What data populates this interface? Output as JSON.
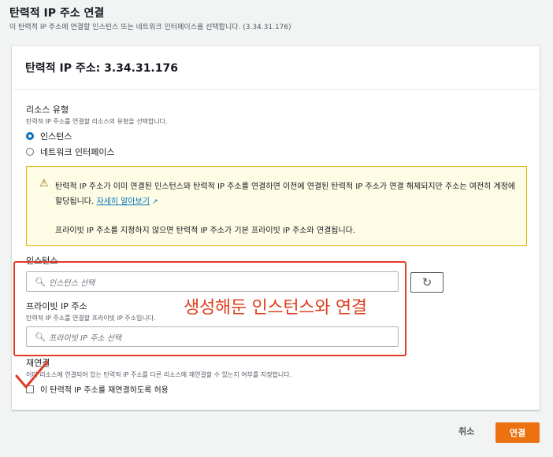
{
  "page": {
    "title": "탄력적 IP 주소 연결",
    "description": "이 탄력적 IP 주소에 연결할 인스턴스 또는 네트워크 인터페이스를 선택합니다. (3.34.31.176)"
  },
  "panel": {
    "title": "탄력적 IP 주소: 3.34.31.176"
  },
  "resource_type": {
    "label": "리소스 유형",
    "hint": "탄력적 IP 주소를 연결할 리소스의 유형을 선택합니다.",
    "options": [
      {
        "label": "인스턴스",
        "selected": true
      },
      {
        "label": "네트워크 인터페이스",
        "selected": false
      }
    ]
  },
  "alert": {
    "text1": "탄력적 IP 주소가 이미 연결된 인스턴스와 탄력적 IP 주소를 연결하면 이전에 연결된 탄력적 IP 주소가 연결 해제되지만 주소는 여전히 계정에 할당됩니다.",
    "link": "자세히 알아보기",
    "text2": "프라이빗 IP 주소를 지정하지 않으면 탄력적 IP 주소가 기본 프라이빗 IP 주소와 연결됩니다.",
    "icon": "warning-icon",
    "color": "#ddb100"
  },
  "instance": {
    "label": "인스턴스",
    "placeholder": "인스턴스 선택"
  },
  "private_ip": {
    "label": "프라이빗 IP 주소",
    "hint": "탄력적 IP 주소를 연결할 프라이빗 IP 주소입니다.",
    "placeholder": "프라이빗 IP 주소 선택"
  },
  "reassociation": {
    "label": "재연결",
    "hint": "이미 리소스에 연결되어 있는 탄력적 IP 주소를 다른 리소스에 재연결할 수 있는지 여부를 지정합니다.",
    "checkbox_label": "이 탄력적 IP 주소를 재연결하도록 허용",
    "checked": false
  },
  "annotation": {
    "text": "생성해둔 인스턴스와 연결",
    "color": "#e03c27"
  },
  "footer": {
    "cancel_label": "취소",
    "submit_label": "연결",
    "accent_color": "#ec7211"
  }
}
